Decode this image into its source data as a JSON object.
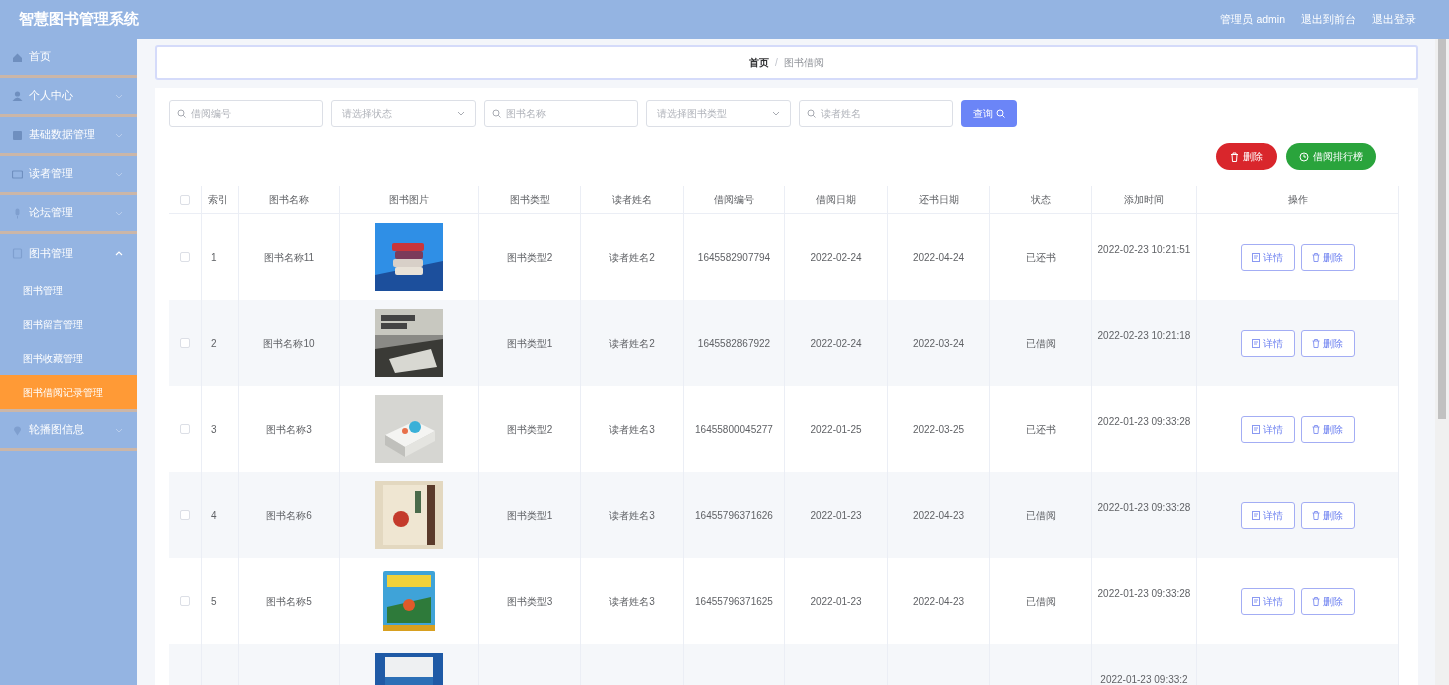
{
  "app_title": "智慧图书管理系统",
  "header_links": [
    "管理员 admin",
    "退出到前台",
    "退出登录"
  ],
  "sidebar": {
    "items": [
      {
        "label": "首页"
      },
      {
        "label": "个人中心",
        "expanded": false
      },
      {
        "label": "基础数据管理",
        "expanded": false
      },
      {
        "label": "读者管理",
        "expanded": false
      },
      {
        "label": "论坛管理",
        "expanded": false
      },
      {
        "label": "图书管理",
        "expanded": true,
        "children": [
          {
            "label": "图书管理",
            "selected": false
          },
          {
            "label": "图书留言管理",
            "selected": false
          },
          {
            "label": "图书收藏管理",
            "selected": false
          },
          {
            "label": "图书借阅记录管理",
            "selected": true
          }
        ]
      },
      {
        "label": "轮播图信息",
        "expanded": false
      }
    ]
  },
  "breadcrumb": {
    "items": [
      "首页",
      "图书借阅"
    ],
    "separator": "/"
  },
  "filters": [
    {
      "kind": "input",
      "placeholder": "借阅编号"
    },
    {
      "kind": "select",
      "placeholder": "请选择状态"
    },
    {
      "kind": "input",
      "placeholder": "图书名称"
    },
    {
      "kind": "select",
      "placeholder": "请选择图书类型"
    },
    {
      "kind": "input",
      "placeholder": "读者姓名"
    }
  ],
  "search_button": "查询",
  "toolbar": [
    {
      "kind": "delete",
      "label": "删除"
    },
    {
      "kind": "ranking",
      "label": "借阅排行榜"
    }
  ],
  "table": {
    "columns": [
      "索引",
      "图书名称",
      "图书图片",
      "图书类型",
      "读者姓名",
      "借阅编号",
      "借阅日期",
      "还书日期",
      "状态",
      "添加时间",
      "操作"
    ],
    "header_checked": false,
    "rows": [
      {
        "checked": false,
        "index": "1",
        "name": "图书名称11",
        "type": "图书类型2",
        "reader": "读者姓名2",
        "borrow_no": "1645582907794",
        "borrow_date": "2022-02-24",
        "return_date": "2022-04-24",
        "status": "已还书",
        "add_time": "2022-02-23 10:21:51",
        "actions": [
          "详情",
          "删除"
        ]
      },
      {
        "checked": false,
        "index": "2",
        "name": "图书名称10",
        "type": "图书类型1",
        "reader": "读者姓名2",
        "borrow_no": "1645582867922",
        "borrow_date": "2022-02-24",
        "return_date": "2022-03-24",
        "status": "已借阅",
        "add_time": "2022-02-23 10:21:18",
        "actions": [
          "详情",
          "删除"
        ]
      },
      {
        "checked": false,
        "index": "3",
        "name": "图书名称3",
        "type": "图书类型2",
        "reader": "读者姓名3",
        "borrow_no": "16455800045277",
        "borrow_date": "2022-01-25",
        "return_date": "2022-03-25",
        "status": "已还书",
        "add_time": "2022-01-23 09:33:28",
        "actions": [
          "详情",
          "删除"
        ]
      },
      {
        "checked": false,
        "index": "4",
        "name": "图书名称6",
        "type": "图书类型1",
        "reader": "读者姓名3",
        "borrow_no": "16455796371626",
        "borrow_date": "2022-01-23",
        "return_date": "2022-04-23",
        "status": "已借阅",
        "add_time": "2022-01-23 09:33:28",
        "actions": [
          "详情",
          "删除"
        ]
      },
      {
        "checked": false,
        "index": "5",
        "name": "图书名称5",
        "type": "图书类型3",
        "reader": "读者姓名3",
        "borrow_no": "16455796371625",
        "borrow_date": "2022-01-23",
        "return_date": "2022-04-23",
        "status": "已借阅",
        "add_time": "2022-01-23 09:33:28",
        "actions": [
          "详情",
          "删除"
        ]
      },
      {
        "add_time": "2022-01-23 09:33:2"
      }
    ]
  }
}
